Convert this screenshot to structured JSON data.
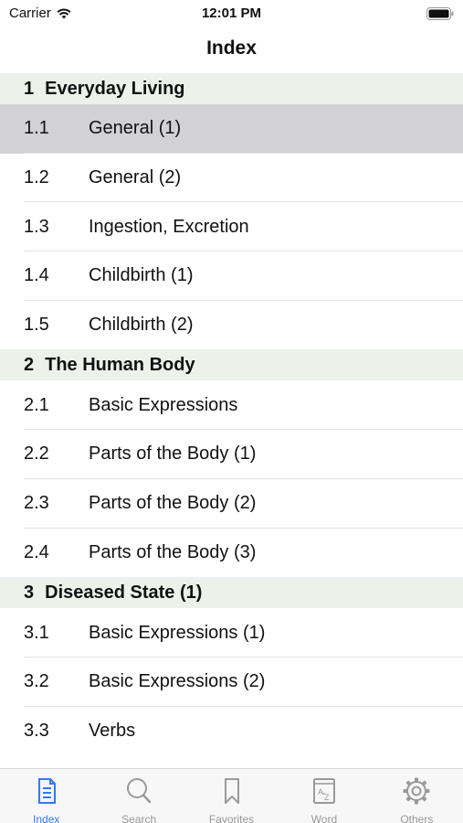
{
  "status_bar": {
    "carrier": "Carrier",
    "time": "12:01 PM"
  },
  "nav": {
    "title": "Index"
  },
  "sections": [
    {
      "num": "1",
      "title": "Everyday Living",
      "rows": [
        {
          "num": "1.1",
          "label": "General (1)",
          "selected": true
        },
        {
          "num": "1.2",
          "label": "General (2)"
        },
        {
          "num": "1.3",
          "label": "Ingestion, Excretion"
        },
        {
          "num": "1.4",
          "label": "Childbirth (1)"
        },
        {
          "num": "1.5",
          "label": "Childbirth (2)"
        }
      ]
    },
    {
      "num": "2",
      "title": "The Human Body",
      "rows": [
        {
          "num": "2.1",
          "label": "Basic Expressions"
        },
        {
          "num": "2.2",
          "label": "Parts of the Body (1)"
        },
        {
          "num": "2.3",
          "label": "Parts of the Body (2)"
        },
        {
          "num": "2.4",
          "label": "Parts of the Body (3)"
        }
      ]
    },
    {
      "num": "3",
      "title": "Diseased State (1)",
      "rows": [
        {
          "num": "3.1",
          "label": "Basic Expressions (1)"
        },
        {
          "num": "3.2",
          "label": "Basic Expressions (2)"
        },
        {
          "num": "3.3",
          "label": "Verbs"
        }
      ]
    }
  ],
  "tabs": [
    {
      "label": "Index",
      "icon": "document-icon",
      "active": true
    },
    {
      "label": "Search",
      "icon": "search-icon"
    },
    {
      "label": "Favorites",
      "icon": "bookmark-icon"
    },
    {
      "label": "Word",
      "icon": "dictionary-icon"
    },
    {
      "label": "Others",
      "icon": "gear-icon"
    }
  ],
  "colors": {
    "accent": "#3478f6",
    "section_bg": "#ecf2ea",
    "selected_bg": "#d1d1d6",
    "inactive_tab": "#999999"
  }
}
